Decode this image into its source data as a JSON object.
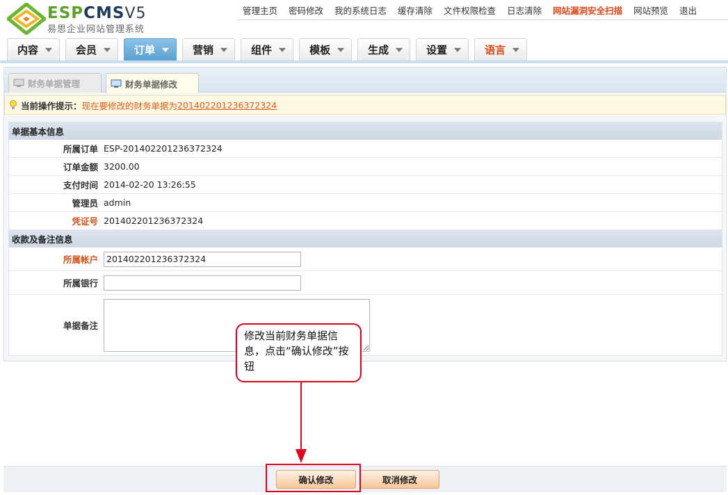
{
  "brand": {
    "esp": "ESP",
    "cms": "CMS",
    "version": "V5",
    "subtitle": "易思企业网站管理系统"
  },
  "top_links": [
    {
      "label": "管理主页",
      "highlight": false
    },
    {
      "label": "密码修改",
      "highlight": false
    },
    {
      "label": "我的系统日志",
      "highlight": false
    },
    {
      "label": "缓存清除",
      "highlight": false
    },
    {
      "label": "文件权限检查",
      "highlight": false
    },
    {
      "label": "日志清除",
      "highlight": false
    },
    {
      "label": "网站漏洞安全扫描",
      "highlight": true
    },
    {
      "label": "网站预览",
      "highlight": false
    },
    {
      "label": "退出",
      "highlight": false
    }
  ],
  "main_tabs": [
    {
      "label": "内容",
      "active": false
    },
    {
      "label": "会员",
      "active": false
    },
    {
      "label": "订单",
      "active": true
    },
    {
      "label": "营销",
      "active": false
    },
    {
      "label": "组件",
      "active": false
    },
    {
      "label": "模板",
      "active": false
    },
    {
      "label": "生成",
      "active": false
    },
    {
      "label": "设置",
      "active": false
    },
    {
      "label": "语言",
      "active": false
    }
  ],
  "sub_tabs": {
    "manage": "财务单据管理",
    "edit": "财务单据修改"
  },
  "tip": {
    "label": "当前操作提示：",
    "message": "现在要修改的财务单据为",
    "number": "201402201236372324"
  },
  "basic_section": {
    "title": "单据基本信息",
    "order_label": "所属订单",
    "order_value": "ESP-201402201236372324",
    "amount_label": "订单金额",
    "amount_value": "3200.00",
    "paytime_label": "支付时间",
    "paytime_value": "2014-02-20 13:26:55",
    "admin_label": "管理员",
    "admin_value": "admin",
    "voucher_label": "凭证号",
    "voucher_value": "201402201236372324"
  },
  "payment_section": {
    "title": "收款及备注信息",
    "account_label": "所属帐户",
    "account_value": "201402201236372324",
    "bank_label": "所属银行",
    "bank_value": "",
    "remark_label": "单据备注",
    "remark_value": ""
  },
  "buttons": {
    "confirm": "确认修改",
    "cancel": "取消修改"
  },
  "callout": {
    "text": "修改当前财务单据信息，点击“确认修改”按钮"
  },
  "colors": {
    "accent_orange": "#e05a1a",
    "active_tab_blue": "#5aa0d2",
    "annotation_red": "#e2001a"
  }
}
